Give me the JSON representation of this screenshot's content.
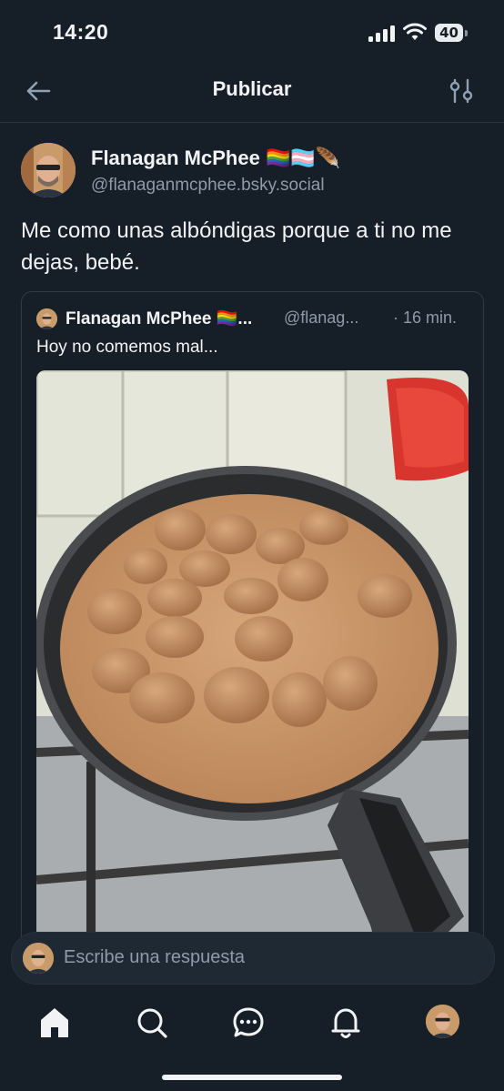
{
  "status_bar": {
    "time": "14:20",
    "battery": "40"
  },
  "header": {
    "title": "Publicar"
  },
  "post": {
    "author_name": "Flanagan McPhee 🏳️‍🌈🏳️‍⚧️🪶",
    "author_handle": "@flanaganmcphee.bsky.social",
    "text": "Me como unas albóndigas porque a ti no me dejas, bebé."
  },
  "quote": {
    "author_name": "Flanagan McPhee 🏳️‍🌈...",
    "author_handle": "@flanag...",
    "time": "· 16 min.",
    "text": "Hoy no comemos mal..."
  },
  "reply": {
    "placeholder": "Escribe una respuesta"
  },
  "colors": {
    "background": "#161e27",
    "muted": "#8f9ba8",
    "text": "#f1f3f5"
  }
}
